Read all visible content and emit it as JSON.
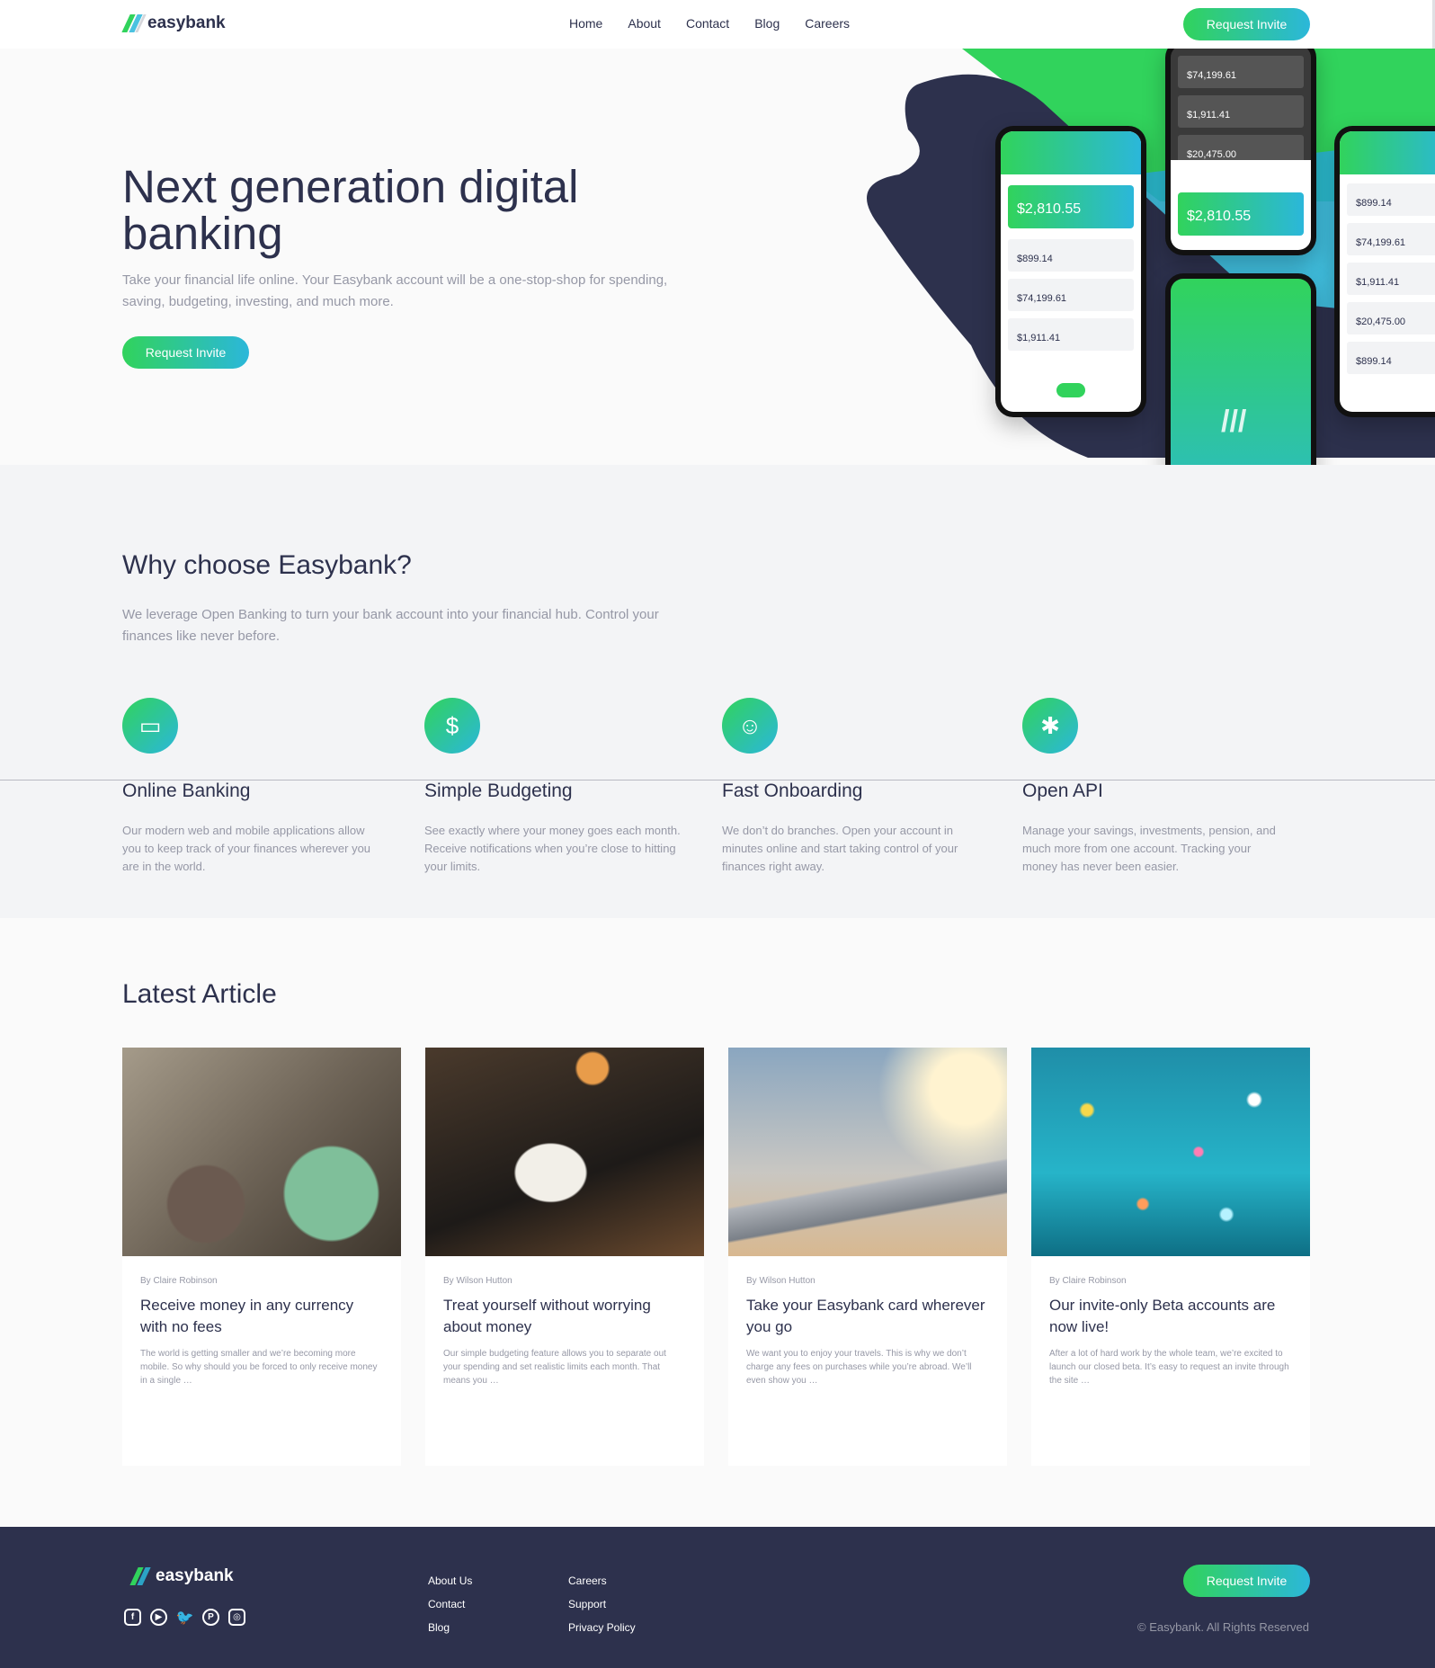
{
  "brand": {
    "name": "easybank"
  },
  "nav": {
    "items": [
      "Home",
      "About",
      "Contact",
      "Blog",
      "Careers"
    ]
  },
  "cta": "Request Invite",
  "hero": {
    "title": "Next generation digital banking",
    "subtitle": "Take your financial life online. Your Easybank account will be a one-stop-shop for spending, saving, budgeting, investing, and much more.",
    "phone_balances": {
      "total": "$2,810.55",
      "accounts": [
        "$899.14",
        "$74,199.61",
        "$1,911.41",
        "$20,475.00"
      ]
    }
  },
  "why": {
    "title": "Why choose Easybank?",
    "lead": "We leverage Open Banking to turn your bank account into your financial hub. Control your finances like never before.",
    "features": [
      {
        "icon": "online-banking-icon",
        "title": "Online Banking",
        "text": "Our modern web and mobile applications allow you to keep track of your finances wherever you are in the world."
      },
      {
        "icon": "budgeting-icon",
        "title": "Simple Budgeting",
        "text": "See exactly where your money goes each month. Receive notifications when you’re close to hitting your limits."
      },
      {
        "icon": "onboarding-icon",
        "title": "Fast Onboarding",
        "text": "We don’t do branches. Open your account in minutes online and start taking control of your finances right away."
      },
      {
        "icon": "api-icon",
        "title": "Open API",
        "text": "Manage your savings, investments, pension, and much more from one account. Tracking your money has never been easier."
      }
    ]
  },
  "articles": {
    "title": "Latest Article",
    "items": [
      {
        "by": "By Claire Robinson",
        "title": "Receive money in any currency with no fees",
        "text": "The world is getting smaller and we’re becoming more mobile. So why should you be forced to only receive money in a single …"
      },
      {
        "by": "By Wilson Hutton",
        "title": "Treat yourself without worrying about money",
        "text": "Our simple budgeting feature allows you to separate out your spending and set realistic limits each month. That means you …"
      },
      {
        "by": "By Wilson Hutton",
        "title": "Take your Easybank card wherever you go",
        "text": "We want you to enjoy your travels. This is why we don’t charge any fees on purchases while you’re abroad. We’ll even show you …"
      },
      {
        "by": "By Claire Robinson",
        "title": "Our invite-only Beta accounts are now live!",
        "text": "After a lot of hard work by the whole team, we’re excited to launch our closed beta. It’s easy to request an invite through the site …"
      }
    ]
  },
  "footer": {
    "col1": [
      "About Us",
      "Contact",
      "Blog"
    ],
    "col2": [
      "Careers",
      "Support",
      "Privacy Policy"
    ],
    "social": [
      "facebook-icon",
      "youtube-icon",
      "twitter-icon",
      "pinterest-icon",
      "instagram-icon"
    ],
    "copyright": "© Easybank. All Rights Reserved"
  },
  "colors": {
    "dark_blue": "#2d314d",
    "lime_green": "#31d35c",
    "bright_cyan": "#2bb7da",
    "grayish_blue": "#9698a6"
  }
}
